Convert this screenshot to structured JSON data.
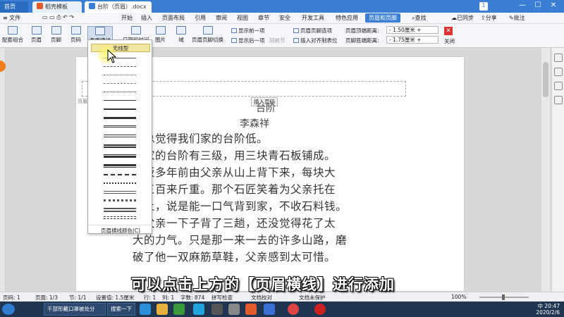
{
  "tabs": {
    "home": "首页",
    "templates": "稻壳模板",
    "document": "台阶（页眉）.docx",
    "badge": "1"
  },
  "window_controls": {
    "minimize": "—",
    "maximize": "☐",
    "close": "✕"
  },
  "menu": {
    "file": "文件",
    "items": [
      "开始",
      "插入",
      "页面布局",
      "引用",
      "审阅",
      "视图",
      "章节",
      "安全",
      "开发工具",
      "特色应用"
    ],
    "active": "页眉和页脚",
    "find": "查找",
    "sync": "已同步",
    "share": "分享",
    "comment": "批注"
  },
  "ribbon": {
    "preset": "配套组合",
    "header": "页眉",
    "footer": "页脚",
    "page_number": "页码",
    "header_line": "页眉横线",
    "datetime": "日期和时间",
    "picture": "图片",
    "field": "域",
    "switch": "页眉页脚切换",
    "show_prev": "显示前一项",
    "show_next": "显示后一项",
    "link_prev": "同前节",
    "hf_options": "页眉页脚选项",
    "insert_align_tab": "插入对齐制表位",
    "header_top_label": "页眉顶端距离:",
    "header_top_value": "1.50厘米",
    "footer_bottom_label": "页脚底端距离:",
    "footer_bottom_value": "1.75厘米",
    "close": "关闭"
  },
  "dropdown": {
    "none": "无线型",
    "footer": "页眉横线颜色(C)"
  },
  "document": {
    "header_tag": "页眉",
    "insert_page_number": "插入页码",
    "title": "台阶",
    "author": "李森祥",
    "lines": [
      "亲总觉得我们家的台阶低。",
      "们家的台阶有三级，用三块青石板铺成。",
      "石板多年前由父亲从山上背下来，每块大",
      "有三百来斤重。那个石匠笑着为父亲托在",
      "膀上，说是能一口气背到家，不收石料钱。",
      "果父亲一下子背了三趟，还没觉得花了太",
      "大的力气。只是那一来一去的许多山路，磨",
      "破了他一双麻筋草鞋，父亲感到太可惜。"
    ]
  },
  "status": {
    "page_no": "页码: 1",
    "page": "页面: 1/3",
    "section": "节: 1/1",
    "setting": "设置值: 1.5厘米",
    "row": "行: 1",
    "col": "列: 1",
    "words": "字数: 874",
    "spell": "拼写检查",
    "proof": "文档校对",
    "protect": "文档未保护",
    "zoom": "100%"
  },
  "taskbar": {
    "item1": "千部形戴口罩被处分",
    "item2": "搜索一下",
    "time": "20:47",
    "date": "2020/2/6",
    "lang": "中"
  },
  "subtitle": "可以点击上方的【页眉横线】进行添加",
  "colors": {
    "accent": "#3a7fd5",
    "taskbar": "#1f3550",
    "close_red": "#dd3333"
  }
}
